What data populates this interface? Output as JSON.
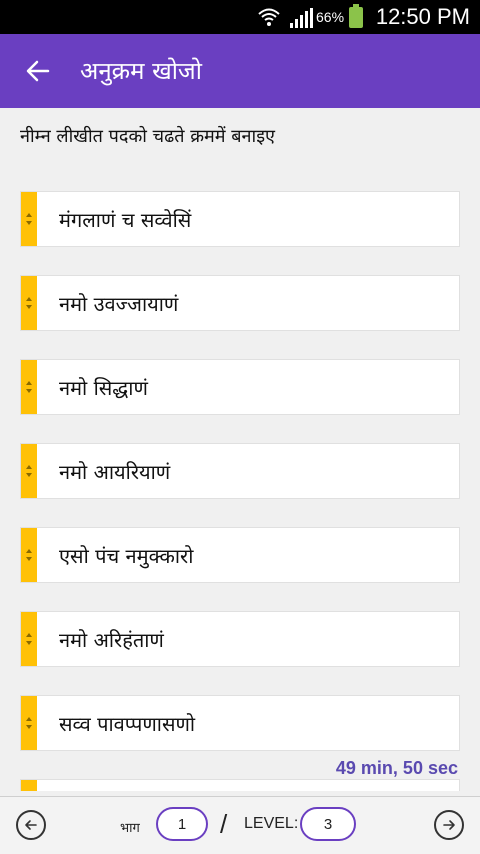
{
  "status_bar": {
    "battery_percent": "66%",
    "time": "12:50 PM"
  },
  "app_bar": {
    "title": "अनुक्रम खोजो"
  },
  "instruction": "नीम्न लीखीत पदको चढते क्रममें बनाइए",
  "items": [
    {
      "label": "मंगलाणं च सव्वेसिं"
    },
    {
      "label": "नमो उवज्जायाणं"
    },
    {
      "label": "नमो सिद्धाणं"
    },
    {
      "label": "नमो आयरियाणं"
    },
    {
      "label": "एसो पंच नमुक्कारो"
    },
    {
      "label": "नमो अरिहंताणं"
    },
    {
      "label": "सव्व पावप्पणासणो"
    }
  ],
  "timer": "49 min, 50 sec",
  "bottom_bar": {
    "bhag_label": "भाग",
    "bhag_value": "1",
    "separator": "/",
    "level_label": "LEVEL:",
    "level_value": "3"
  },
  "colors": {
    "app_bar": "#6a3fc1",
    "handle": "#ffc107",
    "timer": "#5a4ab0"
  }
}
